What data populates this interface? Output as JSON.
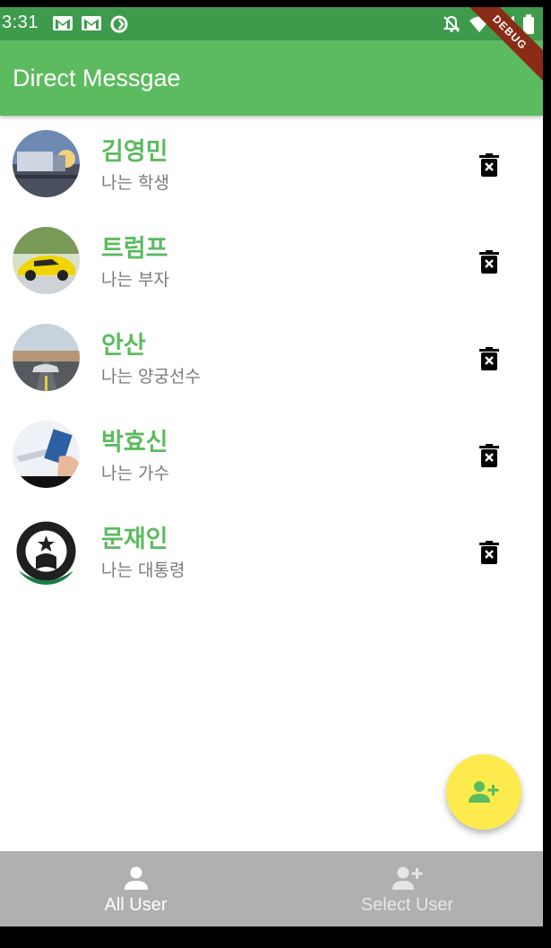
{
  "status_bar": {
    "time": "3:31",
    "icons_left": [
      "gmail-icon",
      "gmail-icon",
      "sync-icon"
    ],
    "icons_right": [
      "notifications-off-icon",
      "wifi-icon",
      "signal-icon",
      "battery-icon"
    ]
  },
  "app_bar": {
    "title": "Direct Messgae",
    "debug_ribbon": "DEBUG",
    "color": "#5cbb5f"
  },
  "users": [
    {
      "name": "김영민",
      "desc": "나는 학생",
      "avatar": "truck-highway-photo"
    },
    {
      "name": "트럼프",
      "desc": "나는 부자",
      "avatar": "yellow-sports-car-photo"
    },
    {
      "name": "안산",
      "desc": "나는 양궁선수",
      "avatar": "car-on-road-photo"
    },
    {
      "name": "박효신",
      "desc": "나는 가수",
      "avatar": "airplane-ticket-photo"
    },
    {
      "name": "문재인",
      "desc": "나는 대통령",
      "avatar": "starbucks-logo"
    }
  ],
  "delete_icon": "delete-forever-icon",
  "fab": {
    "icon": "person-add-icon",
    "color": "#fdeb4d",
    "icon_color": "#5cbb5f"
  },
  "bottom_nav": {
    "items": [
      {
        "label": "All User",
        "icon": "person-icon",
        "active": true
      },
      {
        "label": "Select User",
        "icon": "person-add-icon",
        "active": false
      }
    ],
    "background": "#b0b0b0"
  }
}
